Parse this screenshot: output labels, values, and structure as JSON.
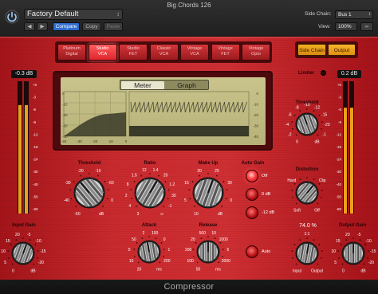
{
  "window": {
    "title": "Big Chords 126"
  },
  "header": {
    "preset": "Factory Default",
    "compare_label": "Compare",
    "copy_label": "Copy",
    "paste_label": "Paste",
    "sidechain_label": "Side Chain:",
    "sidechain_value": "Bus 1",
    "view_label": "View:",
    "view_value": "100%"
  },
  "modes": [
    "Platinum Digital",
    "Studio VCA",
    "Studio FET",
    "Classic VCA",
    "Vintage VCA",
    "Vintage FET",
    "Vintage Opto"
  ],
  "active_mode": "Studio VCA",
  "sidechain_buttons": {
    "side_chain": "Side Chain",
    "output": "Output"
  },
  "display": {
    "tab_meter": "Meter",
    "tab_graph": "Graph",
    "meter_scale_left": [
      "0",
      "-10",
      "-20",
      "-30",
      "-40"
    ],
    "meter_scale_right": [
      "0",
      "-10",
      "-20",
      "-30",
      "-40"
    ],
    "meter_x_scale": [
      "-40",
      "-30",
      "-20",
      "-10",
      "0"
    ],
    "db_label": "dB"
  },
  "input_meter": {
    "value": "-0.3 dB",
    "label": "Input Gain",
    "scale": [
      "+0",
      "-3",
      "-6",
      "-9",
      "-12",
      "-18",
      "-24",
      "-30",
      "-40",
      "-50",
      "-60"
    ]
  },
  "output_meter": {
    "value": "0.2 dB",
    "label": "Output Gain",
    "scale": [
      "+0",
      "-3",
      "-6",
      "-9",
      "-12",
      "-18",
      "-24",
      "-30",
      "-40",
      "-50",
      "-60"
    ]
  },
  "threshold": {
    "label": "Threshold",
    "ticks": [
      "-50",
      "-40",
      "-30",
      "-20",
      "-10",
      "-60",
      "0",
      "dB"
    ]
  },
  "ratio": {
    "label": "Ratio",
    "ticks": [
      "3",
      "4",
      "2",
      "8",
      "1.5",
      "12",
      "1.4",
      "20",
      "1.2",
      "30",
      "-1",
      "∞"
    ]
  },
  "makeup": {
    "label": "Make Up",
    "ticks": [
      "10",
      "5",
      "15",
      "20",
      "25",
      "30",
      "0",
      "dB"
    ]
  },
  "auto_gain": {
    "label": "Auto Gain",
    "options": [
      "Off",
      "0 dB",
      "-12 dB"
    ],
    "active": "Off",
    "auto_label": "Auto"
  },
  "attack": {
    "label": "Attack",
    "ticks": [
      "20",
      "10",
      "5",
      "50",
      "2",
      "100",
      "0",
      "1",
      "200",
      "ms"
    ]
  },
  "release": {
    "label": "Release",
    "ticks": [
      "50",
      "100",
      "200",
      "20",
      "500",
      "10",
      "1000",
      "5",
      "2000",
      "ms"
    ]
  },
  "limiter": {
    "label": "Limiter",
    "threshold_label": "Threshold",
    "ticks": [
      "0",
      "-2",
      "-4",
      "-6",
      "-8",
      "-10",
      "-12",
      "-15",
      "-20",
      "-1",
      "dB"
    ]
  },
  "distortion": {
    "label": "Distortion",
    "options": [
      "Soft",
      "Hard",
      "Clip",
      "Off"
    ]
  },
  "mix": {
    "value": "74.0 %",
    "ratio_label": "1:1",
    "input_label": "Input",
    "output_label": "Output"
  },
  "input_gain_ticks": [
    "0",
    "5",
    "10",
    "15",
    "20",
    "-5",
    "-10",
    "-15",
    "-20",
    "dB"
  ],
  "output_gain_ticks": [
    "0",
    "5",
    "10",
    "15",
    "20",
    "-5",
    "-10",
    "-15",
    "-20",
    "dB"
  ],
  "plugin_name": "Compressor",
  "levels": {
    "input_meter": 0.82,
    "output_meter": 0.8
  },
  "colors": {
    "accent_red": "#cf2f33",
    "active_mode": "#ff5c5f",
    "side_chain_orange": "#f0a11a"
  }
}
